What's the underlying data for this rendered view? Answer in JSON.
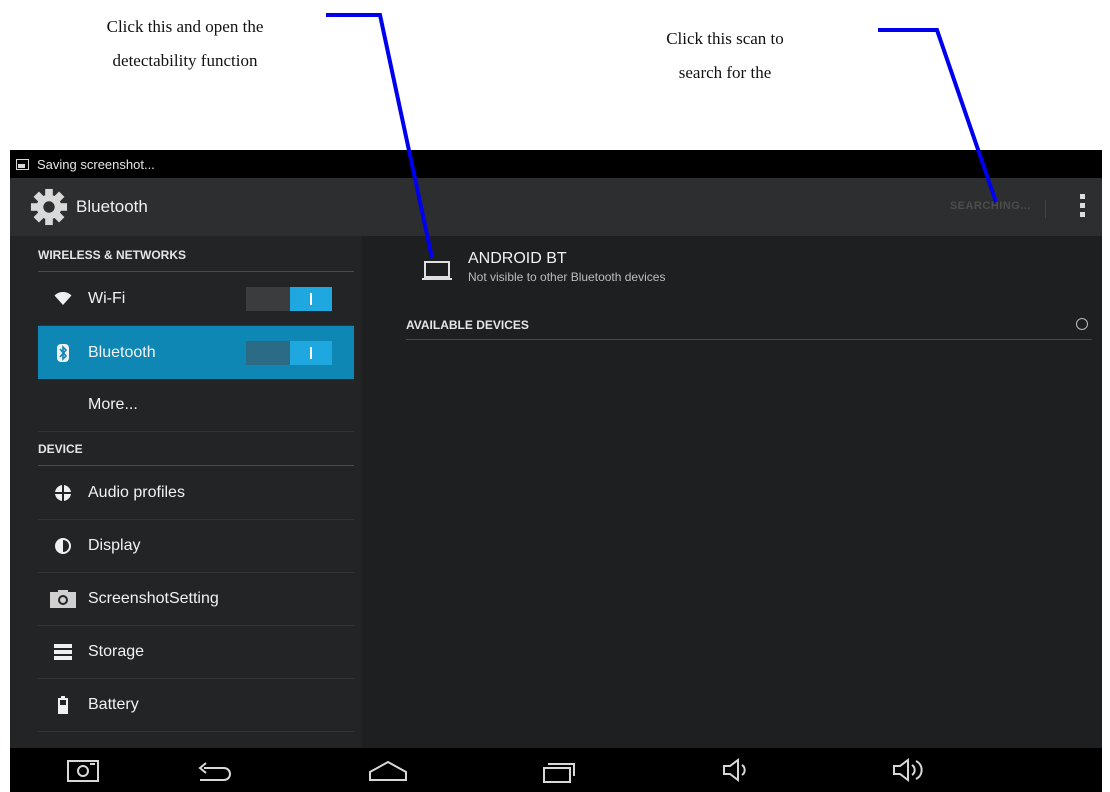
{
  "annotations": {
    "left_line1": "Click this and open the",
    "left_line2": "detectability function",
    "right_line1": "Click this scan to",
    "right_line2": "search for the",
    "line_color": "#0000ff"
  },
  "status_bar": {
    "text": "Saving screenshot..."
  },
  "action_bar": {
    "title": "Bluetooth",
    "icon": "gear-icon",
    "searching_label": "SEARCHING...",
    "overflow_icon": "overflow-menu-icon"
  },
  "sidebar": {
    "section_wireless": "WIRELESS & NETWORKS",
    "section_device": "DEVICE",
    "items": [
      {
        "label": "Wi-Fi",
        "icon": "wifi-icon",
        "toggle": "on"
      },
      {
        "label": "Bluetooth",
        "icon": "bluetooth-icon",
        "toggle": "on",
        "selected": true
      },
      {
        "label": "More..."
      },
      {
        "label": "Audio profiles",
        "icon": "audio-profiles-icon"
      },
      {
        "label": "Display",
        "icon": "display-icon"
      },
      {
        "label": "ScreenshotSetting",
        "icon": "camera-icon"
      },
      {
        "label": "Storage",
        "icon": "storage-icon"
      },
      {
        "label": "Battery",
        "icon": "battery-icon"
      }
    ]
  },
  "main": {
    "device_name": "ANDROID BT",
    "device_status": "Not visible to other Bluetooth devices",
    "available_header": "AVAILABLE DEVICES"
  },
  "nav_bar": {
    "buttons": [
      "screenshot-icon",
      "back-icon",
      "home-icon",
      "recents-icon",
      "volume-down-icon",
      "volume-up-icon"
    ]
  },
  "colors": {
    "accent": "#0e87b4",
    "toggle_on": "#1fa8df",
    "background": "#1e1f21"
  }
}
